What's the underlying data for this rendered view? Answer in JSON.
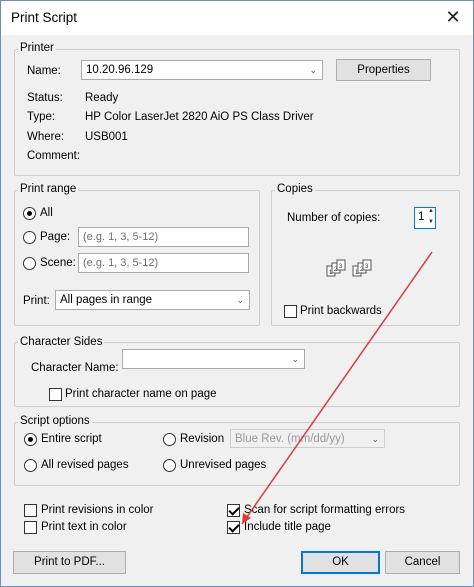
{
  "window": {
    "title": "Print Script",
    "close_glyph": "✕"
  },
  "printer": {
    "group_label": "Printer",
    "name_label": "Name:",
    "name_value": "10.20.96.129",
    "properties_label": "Properties",
    "status_label": "Status:",
    "status_value": "Ready",
    "type_label": "Type:",
    "type_value": "HP Color LaserJet 2820 AiO PS Class Driver",
    "where_label": "Where:",
    "where_value": "USB001",
    "comment_label": "Comment:"
  },
  "print_range": {
    "group_label": "Print range",
    "all_label": "All",
    "page_label": "Page:",
    "page_placeholder": "(e.g. 1, 3, 5-12)",
    "scene_label": "Scene:",
    "scene_placeholder": "(e.g. 1, 3, 5-12)",
    "print_label": "Print:",
    "print_value": "All pages in range",
    "selected": "All"
  },
  "copies": {
    "group_label": "Copies",
    "number_label": "Number of copies:",
    "number_value": "1",
    "print_backwards_label": "Print backwards",
    "print_backwards_checked": false
  },
  "character_sides": {
    "group_label": "Character Sides",
    "character_name_label": "Character Name:",
    "character_name_value": "",
    "print_character_name_label": "Print character name on page",
    "print_character_name_checked": false
  },
  "script_options": {
    "group_label": "Script options",
    "entire_script_label": "Entire script",
    "revision_label": "Revision",
    "revision_value": "Blue Rev. (mm/dd/yy)",
    "all_revised_label": "All revised pages",
    "unrevised_label": "Unrevised pages",
    "selected": "Entire script"
  },
  "options": {
    "print_revisions_color_label": "Print revisions in color",
    "print_revisions_color_checked": false,
    "print_text_color_label": "Print text in color",
    "print_text_color_checked": false,
    "scan_formatting_label": "Scan for script formatting errors",
    "scan_formatting_checked": true,
    "include_title_label": "Include title page",
    "include_title_checked": true
  },
  "footer": {
    "print_pdf_label": "Print to PDF...",
    "ok_label": "OK",
    "cancel_label": "Cancel"
  },
  "annotation": {
    "arrow_color": "#d93b3b"
  }
}
